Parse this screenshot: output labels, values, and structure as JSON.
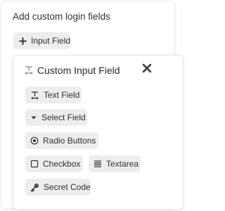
{
  "panel": {
    "title": "Add custom login fields",
    "add_button_label": "Input Field",
    "add_button_icon": "plus-icon"
  },
  "dialog": {
    "title": "Custom Input Field",
    "title_icon": "text-field-icon",
    "close_icon": "close-icon",
    "options": [
      {
        "label": "Text Field",
        "icon": "text-field-icon"
      },
      {
        "label": "Select Field",
        "icon": "caret-down-icon"
      },
      {
        "label": "Radio Buttons",
        "icon": "radio-icon"
      },
      {
        "label": "Checkbox",
        "icon": "checkbox-icon"
      },
      {
        "label": "Textarea",
        "icon": "lines-icon"
      },
      {
        "label": "Secret Code",
        "icon": "key-icon"
      }
    ]
  }
}
